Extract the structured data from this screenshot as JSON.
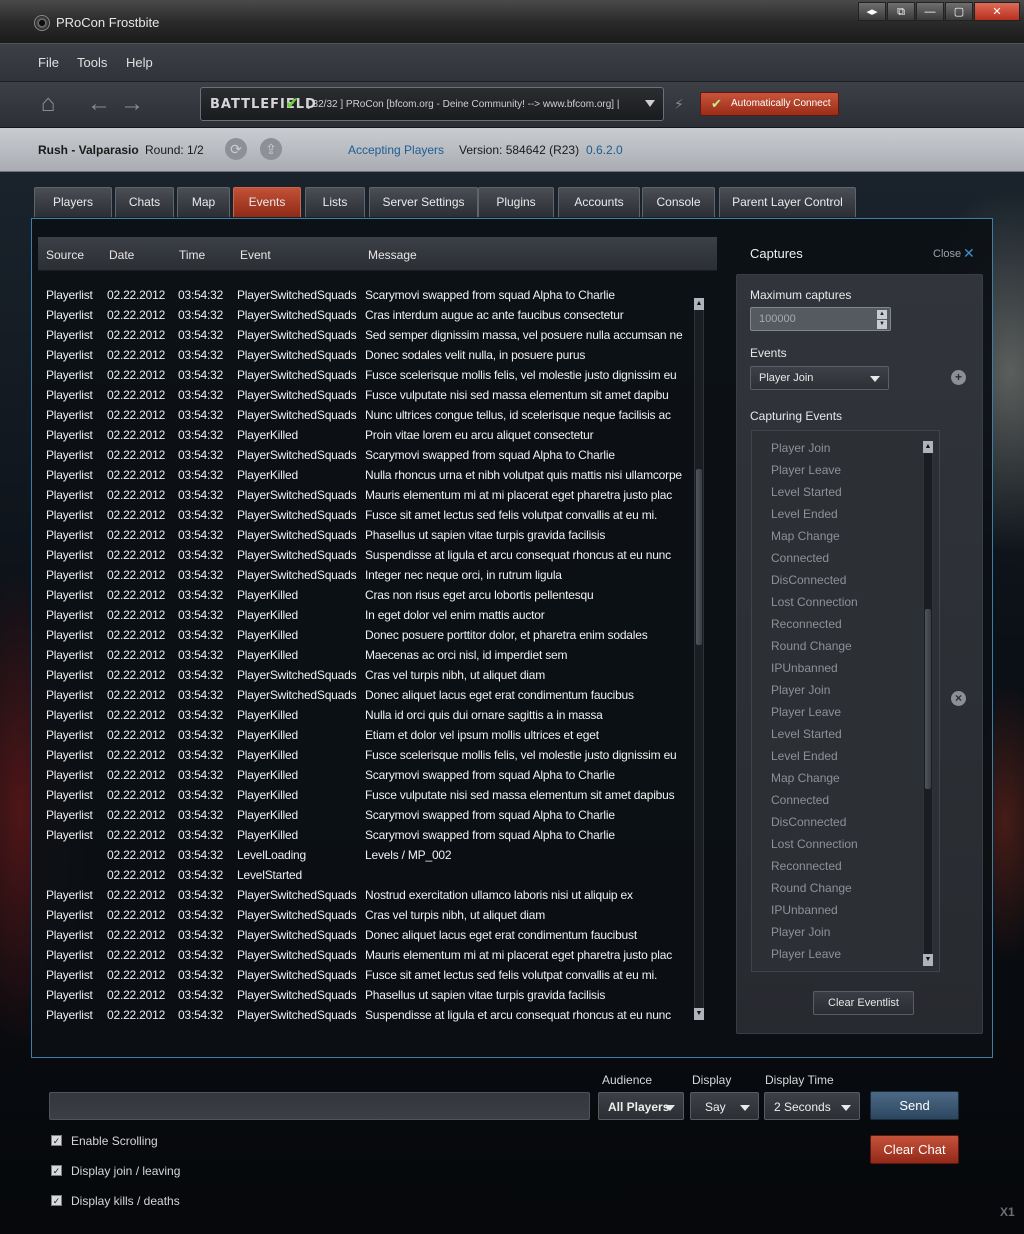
{
  "window": {
    "title": "PRoCon Frostbite",
    "buttons": [
      "◂▸",
      "⧉",
      "—",
      "▢",
      "✕"
    ]
  },
  "menu": [
    "File",
    "Tools",
    "Help"
  ],
  "nav": {
    "home_icon": "⌂",
    "back_icon": "←",
    "forward_icon": "→",
    "server_logo": "BATTLEFIELD",
    "server_check": "✔",
    "server_text": "[ 32/32 ] PRoCon [bfcom.org - Deine Community! --> www.bfcom.org] |",
    "plug_icon": "⚡",
    "auto_connect_check": "✔",
    "auto_connect_label": "Automatically Connect"
  },
  "status": {
    "map": "Rush - Valparasio",
    "round": "Round: 1/2",
    "refresh_icon": "⟳",
    "upload_icon": "⇪",
    "state": "Accepting Players",
    "version": "Version: 584642 (R23)",
    "procon_version": "0.6.2.0"
  },
  "tabs": [
    "Players",
    "Chats",
    "Map",
    "Events",
    "Lists",
    "Server Settings",
    "Plugins",
    "Accounts",
    "Console",
    "Parent Layer Control"
  ],
  "events_table": {
    "columns": [
      "Source",
      "Date",
      "Time",
      "Event",
      "Message"
    ],
    "rows": [
      [
        "Playerlist",
        "02.22.2012",
        "03:54:32",
        "PlayerSwitchedSquads",
        "Scarymovi swapped from squad Alpha to Charlie"
      ],
      [
        "Playerlist",
        "02.22.2012",
        "03:54:32",
        "PlayerSwitchedSquads",
        "Cras interdum augue ac ante faucibus consectetur"
      ],
      [
        "Playerlist",
        "02.22.2012",
        "03:54:32",
        "PlayerSwitchedSquads",
        "Sed semper dignissim massa, vel posuere nulla accumsan ne"
      ],
      [
        "Playerlist",
        "02.22.2012",
        "03:54:32",
        "PlayerSwitchedSquads",
        "Donec sodales velit nulla, in posuere purus"
      ],
      [
        "Playerlist",
        "02.22.2012",
        "03:54:32",
        "PlayerSwitchedSquads",
        "Fusce scelerisque mollis felis, vel molestie justo dignissim eu"
      ],
      [
        "Playerlist",
        "02.22.2012",
        "03:54:32",
        "PlayerSwitchedSquads",
        "Fusce vulputate nisi sed massa elementum sit amet dapibu"
      ],
      [
        "Playerlist",
        "02.22.2012",
        "03:54:32",
        "PlayerSwitchedSquads",
        "Nunc ultrices congue tellus, id scelerisque neque facilisis ac"
      ],
      [
        "Playerlist",
        "02.22.2012",
        "03:54:32",
        "PlayerKilled",
        "Proin vitae lorem eu arcu aliquet consectetur"
      ],
      [
        "Playerlist",
        "02.22.2012",
        "03:54:32",
        "PlayerSwitchedSquads",
        "Scarymovi swapped from squad Alpha to Charlie"
      ],
      [
        "Playerlist",
        "02.22.2012",
        "03:54:32",
        "PlayerKilled",
        "Nulla rhoncus urna et nibh volutpat quis mattis nisi ullamcorpe"
      ],
      [
        "Playerlist",
        "02.22.2012",
        "03:54:32",
        "PlayerSwitchedSquads",
        "Mauris elementum mi at mi placerat eget pharetra justo plac"
      ],
      [
        "Playerlist",
        "02.22.2012",
        "03:54:32",
        "PlayerSwitchedSquads",
        "Fusce sit amet lectus sed felis volutpat convallis at eu mi."
      ],
      [
        "Playerlist",
        "02.22.2012",
        "03:54:32",
        "PlayerSwitchedSquads",
        "Phasellus ut sapien vitae turpis gravida facilisis"
      ],
      [
        "Playerlist",
        "02.22.2012",
        "03:54:32",
        "PlayerSwitchedSquads",
        "Suspendisse at ligula et arcu consequat rhoncus at eu nunc"
      ],
      [
        "Playerlist",
        "02.22.2012",
        "03:54:32",
        "PlayerSwitchedSquads",
        "Integer nec neque orci, in rutrum ligula"
      ],
      [
        "Playerlist",
        "02.22.2012",
        "03:54:32",
        "PlayerKilled",
        "Cras non risus eget arcu lobortis pellentesqu"
      ],
      [
        "Playerlist",
        "02.22.2012",
        "03:54:32",
        "PlayerKilled",
        "In eget dolor vel enim mattis auctor"
      ],
      [
        "Playerlist",
        "02.22.2012",
        "03:54:32",
        "PlayerKilled",
        "Donec posuere porttitor dolor, et pharetra enim sodales"
      ],
      [
        "Playerlist",
        "02.22.2012",
        "03:54:32",
        "PlayerKilled",
        "Maecenas ac orci nisl, id imperdiet sem"
      ],
      [
        "Playerlist",
        "02.22.2012",
        "03:54:32",
        "PlayerSwitchedSquads",
        "Cras vel turpis nibh, ut aliquet diam"
      ],
      [
        "Playerlist",
        "02.22.2012",
        "03:54:32",
        "PlayerSwitchedSquads",
        "Donec aliquet lacus eget erat condimentum faucibus"
      ],
      [
        "Playerlist",
        "02.22.2012",
        "03:54:32",
        "PlayerKilled",
        "Nulla id orci quis dui ornare sagittis a in massa"
      ],
      [
        "Playerlist",
        "02.22.2012",
        "03:54:32",
        "PlayerKilled",
        "Etiam et dolor vel ipsum mollis ultrices et eget"
      ],
      [
        "Playerlist",
        "02.22.2012",
        "03:54:32",
        "PlayerKilled",
        "Fusce scelerisque mollis felis, vel molestie justo dignissim eu"
      ],
      [
        "Playerlist",
        "02.22.2012",
        "03:54:32",
        "PlayerKilled",
        "Scarymovi swapped from squad Alpha to Charlie"
      ],
      [
        "Playerlist",
        "02.22.2012",
        "03:54:32",
        "PlayerKilled",
        "Fusce vulputate nisi sed massa elementum sit amet dapibus"
      ],
      [
        "Playerlist",
        "02.22.2012",
        "03:54:32",
        "PlayerKilled",
        "Scarymovi swapped from squad Alpha to Charlie"
      ],
      [
        "Playerlist",
        "02.22.2012",
        "03:54:32",
        "PlayerKilled",
        "Scarymovi swapped from squad Alpha to Charlie"
      ],
      [
        "",
        "02.22.2012",
        "03:54:32",
        "LevelLoading",
        "Levels / MP_002"
      ],
      [
        "",
        "02.22.2012",
        "03:54:32",
        "LevelStarted",
        ""
      ],
      [
        "Playerlist",
        "02.22.2012",
        "03:54:32",
        "PlayerSwitchedSquads",
        "Nostrud exercitation ullamco laboris nisi ut aliquip ex"
      ],
      [
        "Playerlist",
        "02.22.2012",
        "03:54:32",
        "PlayerSwitchedSquads",
        "Cras vel turpis nibh, ut aliquet diam"
      ],
      [
        "Playerlist",
        "02.22.2012",
        "03:54:32",
        "PlayerSwitchedSquads",
        "Donec aliquet lacus eget erat condimentum faucibust"
      ],
      [
        "Playerlist",
        "02.22.2012",
        "03:54:32",
        "PlayerSwitchedSquads",
        "Mauris elementum mi at mi placerat eget pharetra justo plac"
      ],
      [
        "Playerlist",
        "02.22.2012",
        "03:54:32",
        "PlayerSwitchedSquads",
        "Fusce sit amet lectus sed felis volutpat convallis at eu mi."
      ],
      [
        "Playerlist",
        "02.22.2012",
        "03:54:32",
        "PlayerSwitchedSquads",
        "Phasellus ut sapien vitae turpis gravida facilisis"
      ],
      [
        "Playerlist",
        "02.22.2012",
        "03:54:32",
        "PlayerSwitchedSquads",
        "Suspendisse at ligula et arcu consequat rhoncus at eu nunc"
      ]
    ]
  },
  "captures": {
    "title": "Captures",
    "close_label": "Close",
    "close_icon": "✕",
    "max_label": "Maximum captures",
    "max_value": "100000",
    "spin_up": "▲",
    "spin_down": "▼",
    "events_label": "Events",
    "events_selected": "Player Join",
    "add_icon": "+",
    "remove_icon": "×",
    "capturing_label": "Capturing Events",
    "capturing_events": [
      "Player Join",
      "Player Leave",
      "Level Started",
      "Level Ended",
      "Map Change",
      "Connected",
      "DisConnected",
      "Lost Connection",
      "Reconnected",
      "Round Change",
      "IPUnbanned",
      "Player Join",
      "Player Leave",
      "Level Started",
      "Level Ended",
      "Map Change",
      "Connected",
      "DisConnected",
      "Lost Connection",
      "Reconnected",
      "Round Change",
      "IPUnbanned",
      "Player Join",
      "Player Leave"
    ],
    "clear_label": "Clear Eventlist"
  },
  "chat": {
    "input_value": "",
    "audience_label": "Audience",
    "audience_value": "All Players",
    "display_label": "Display",
    "display_value": "Say",
    "display_time_label": "Display Time",
    "display_time_value": "2 Seconds",
    "send_label": "Send",
    "clear_label": "Clear Chat",
    "options": [
      {
        "label": "Enable Scrolling",
        "checked": true
      },
      {
        "label": "Display join / leaving",
        "checked": true
      },
      {
        "label": "Display kills / deaths",
        "checked": true
      }
    ],
    "check_glyph": "✓"
  },
  "corner_tag": "X1"
}
